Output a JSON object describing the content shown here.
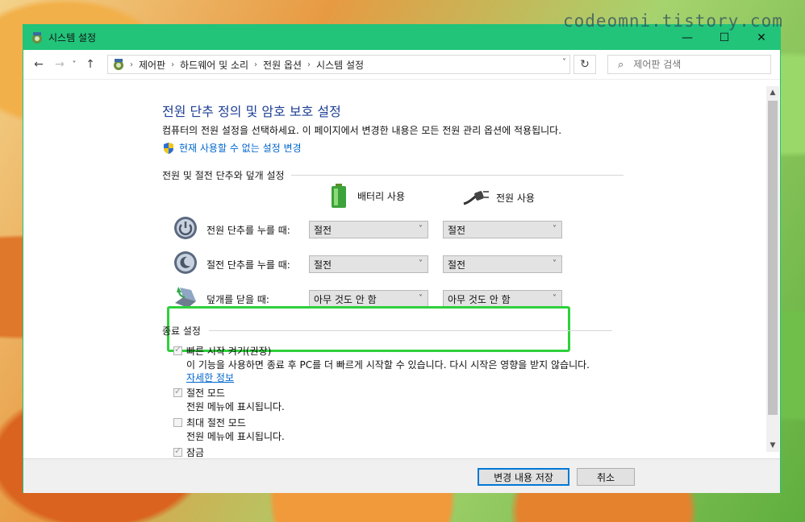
{
  "watermark": "codeomni.tistory.com",
  "window": {
    "title": "시스템 설정",
    "controls": {
      "minimize": "—",
      "maximize": "☐",
      "close": "✕"
    }
  },
  "nav": {
    "back": "←",
    "forward": "→",
    "recent": "˅",
    "up": "↑",
    "breadcrumbs": [
      "제어판",
      "하드웨어 및 소리",
      "전원 옵션",
      "시스템 설정"
    ],
    "separator": "›",
    "dropdown": "˅",
    "refresh": "↻",
    "search_placeholder": "제어판 검색"
  },
  "page": {
    "title": "전원 단추 정의 및 암호 보호 설정",
    "description": "컴퓨터의 전원 설정을 선택하세요. 이 페이지에서 변경한 내용은 모든 전원 관리 옵션에 적용됩니다.",
    "change_link": "현재 사용할 수 없는 설정 변경"
  },
  "power_section": {
    "heading": "전원 및 절전 단추와 덮개 설정",
    "columns": {
      "battery": "배터리 사용",
      "plugged": "전원 사용"
    },
    "rows": [
      {
        "label": "전원 단추를 누를 때:",
        "battery": "절전",
        "plugged": "절전"
      },
      {
        "label": "절전 단추를 누를 때:",
        "battery": "절전",
        "plugged": "절전"
      },
      {
        "label": "덮개를 닫을 때:",
        "battery": "아무 것도 안 함",
        "plugged": "아무 것도 안 함"
      }
    ]
  },
  "shutdown_section": {
    "heading": "종료 설정",
    "items": [
      {
        "label": "빠른 시작 켜기(권장)",
        "checked": true,
        "desc": "이 기능을 사용하면 종료 후 PC를 더 빠르게 시작할 수 있습니다. 다시 시작은 영향을 받지 않습니다.",
        "link": "자세한 정보"
      },
      {
        "label": "절전 모드",
        "checked": true,
        "desc": "전원 메뉴에 표시됩니다."
      },
      {
        "label": "최대 절전 모드",
        "checked": false,
        "desc": "전원 메뉴에 표시됩니다."
      },
      {
        "label": "잠금",
        "checked": true
      }
    ]
  },
  "footer": {
    "save": "변경 내용 저장",
    "cancel": "취소"
  },
  "colors": {
    "titlebar": "#22c47a",
    "link": "#0066cc",
    "title": "#1e3f94",
    "highlight": "#2fd03c"
  }
}
